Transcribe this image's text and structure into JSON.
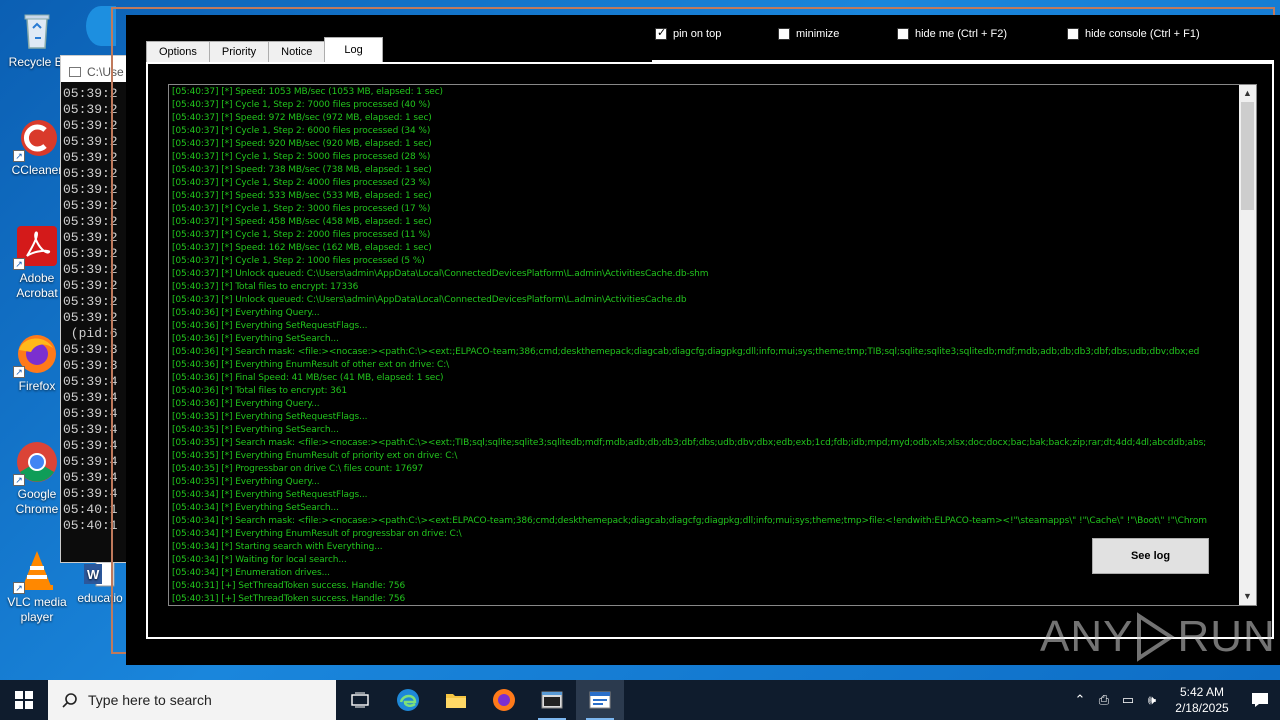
{
  "desktop": {
    "icons": [
      {
        "label": "Recycle Bin",
        "icon": "recycle-bin-icon"
      },
      {
        "label": "CCleaner",
        "icon": "ccleaner-icon"
      },
      {
        "label": "Adobe Acrobat",
        "icon": "adobe-acrobat-icon"
      },
      {
        "label": "Firefox",
        "icon": "firefox-icon"
      },
      {
        "label": "Google Chrome",
        "icon": "chrome-icon"
      },
      {
        "label": "VLC media player",
        "icon": "vlc-icon"
      },
      {
        "label": "education",
        "icon": "word-document-icon"
      }
    ],
    "visible_labels": {
      "recycle": "Recycle Bi",
      "ccleaner": "CCleaner",
      "acrobat1": "Adobe",
      "acrobat2": "Acrobat",
      "firefox": "Firefox",
      "chrome1": "Google",
      "chrome2": "Chrome",
      "vlc1": "VLC media",
      "vlc2": "player",
      "education": "educatio"
    }
  },
  "console": {
    "title": "C:\\Use",
    "lines": [
      "05:39:2",
      "05:39:2",
      "05:39:2",
      "05:39:2",
      "05:39:2",
      "05:39:2",
      "05:39:2",
      "05:39:2",
      "05:39:2",
      "05:39:2",
      "05:39:2",
      "05:39:2",
      "05:39:2",
      "05:39:2",
      "05:39:2",
      " (pid:6",
      "05:39:3",
      "05:39:3",
      "05:39:4",
      "05:39:4",
      "05:39:4",
      "05:39:4",
      "05:39:4",
      "05:39:4",
      "05:39:4",
      "05:39:4",
      "05:40:1",
      "05:40:1"
    ]
  },
  "app": {
    "tabs": [
      "Options",
      "Priority",
      "Notice",
      "Log"
    ],
    "active_tab": "Log",
    "options": [
      {
        "label": "pin on top",
        "checked": true
      },
      {
        "label": "minimize",
        "checked": false
      },
      {
        "label": "hide me (Ctrl + F2)",
        "checked": false
      },
      {
        "label": "hide console (Ctrl + F1)",
        "checked": false
      }
    ],
    "see_log_label": "See log",
    "log_color": "#22c41d",
    "log_lines": [
      "[05:40:37] [*] Speed: 1053 MB/sec (1053 MB, elapsed: 1 sec)",
      "[05:40:37] [*] Cycle 1, Step 2: 7000 files processed (40 %)",
      "[05:40:37] [*] Speed: 972 MB/sec (972 MB, elapsed: 1 sec)",
      "[05:40:37] [*] Cycle 1, Step 2: 6000 files processed (34 %)",
      "[05:40:37] [*] Speed: 920 MB/sec (920 MB, elapsed: 1 sec)",
      "[05:40:37] [*] Cycle 1, Step 2: 5000 files processed (28 %)",
      "[05:40:37] [*] Speed: 738 MB/sec (738 MB, elapsed: 1 sec)",
      "[05:40:37] [*] Cycle 1, Step 2: 4000 files processed (23 %)",
      "[05:40:37] [*] Speed: 533 MB/sec (533 MB, elapsed: 1 sec)",
      "[05:40:37] [*] Cycle 1, Step 2: 3000 files processed (17 %)",
      "[05:40:37] [*] Speed: 458 MB/sec (458 MB, elapsed: 1 sec)",
      "[05:40:37] [*] Cycle 1, Step 2: 2000 files processed (11 %)",
      "[05:40:37] [*] Speed: 162 MB/sec (162 MB, elapsed: 1 sec)",
      "[05:40:37] [*] Cycle 1, Step 2: 1000 files processed (5 %)",
      "[05:40:37] [*] Unlock queued: C:\\Users\\admin\\AppData\\Local\\ConnectedDevicesPlatform\\L.admin\\ActivitiesCache.db-shm",
      "[05:40:37] [*] Total files to encrypt: 17336",
      "[05:40:37] [*] Unlock queued: C:\\Users\\admin\\AppData\\Local\\ConnectedDevicesPlatform\\L.admin\\ActivitiesCache.db",
      "[05:40:36] [*] Everything Query...",
      "[05:40:36] [*] Everything SetRequestFlags...",
      "[05:40:36] [*] Everything SetSearch...",
      "[05:40:36] [*] Search mask: <file:><nocase:><path:C:\\><ext:;ELPACO-team;386;cmd;deskthemepack;diagcab;diagcfg;diagpkg;dll;info;mui;sys;theme;tmp;TIB;sql;sqlite;sqlite3;sqlitedb;mdf;mdb;adb;db;db3;dbf;dbs;udb;dbv;dbx;ed",
      "[05:40:36] [*] Everything EnumResult of other ext on drive: C:\\",
      "[05:40:36] [*] Final Speed: 41 MB/sec (41 MB, elapsed: 1 sec)",
      "[05:40:36] [*] Total files to encrypt: 361",
      "[05:40:36] [*] Everything Query...",
      "[05:40:35] [*] Everything SetRequestFlags...",
      "[05:40:35] [*] Everything SetSearch...",
      "[05:40:35] [*] Search mask: <file:><nocase:><path:C:\\><ext:;TIB;sql;sqlite;sqlite3;sqlitedb;mdf;mdb;adb;db;db3;dbf;dbs;udb;dbv;dbx;edb;exb;1cd;fdb;idb;mpd;myd;odb;xls;xlsx;doc;docx;bac;bak;back;zip;rar;dt;4dd;4dl;abcddb;abs;",
      "[05:40:35] [*] Everything EnumResult of priority ext on drive: C:\\",
      "[05:40:35] [*] Progressbar on drive C:\\ files count: 17697",
      "[05:40:35] [*] Everything Query...",
      "[05:40:34] [*] Everything SetRequestFlags...",
      "[05:40:34] [*] Everything SetSearch...",
      "[05:40:34] [*] Search mask: <file:><nocase:><path:C:\\><ext:ELPACO-team;386;cmd;deskthemepack;diagcab;diagcfg;diagpkg;dll;info;mui;sys;theme;tmp>file:<!endwith:ELPACO-team><!\"\\steamapps\\\" !\"\\Cache\\\" !\"\\Boot\\\" !\"\\Chrom",
      "[05:40:34] [*] Everything EnumResult of progressbar on drive: C:\\",
      "[05:40:34] [*] Starting search with Everything...",
      "[05:40:34] [*] Waiting for local search...",
      "[05:40:34] [*] Enumeration drives...",
      "[05:40:31] [+] SetThreadToken success. Handle: 756",
      "[05:40:31] [+] SetThreadToken success. Handle: 756"
    ]
  },
  "watermark": {
    "left": "ANY",
    "right": "RUN"
  },
  "taskbar": {
    "search_placeholder": "Type here to search",
    "time": "5:42 AM",
    "date": "2/18/2025"
  }
}
